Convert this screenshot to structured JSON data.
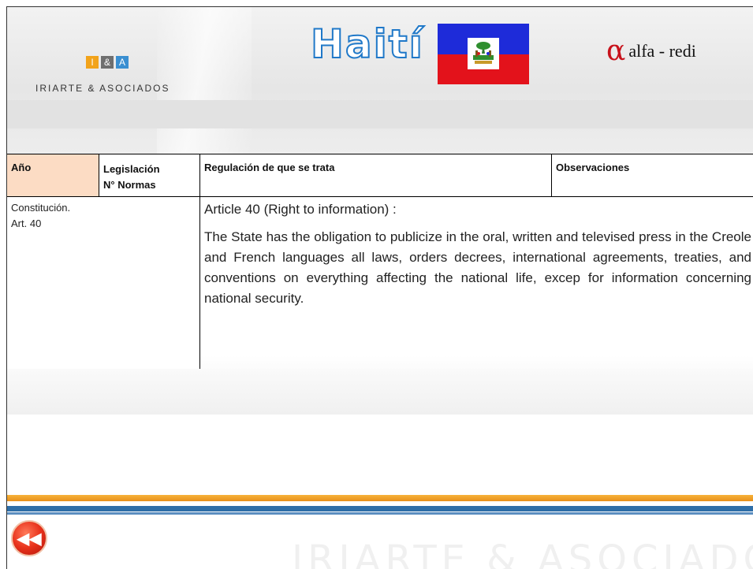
{
  "header": {
    "ia_logo": {
      "letter_i": "I",
      "letter_amp": "&",
      "letter_a": "A",
      "company": "IRIARTE & ASOCIADOS"
    },
    "title": "Haití",
    "flag": {
      "country": "Haiti",
      "colors": {
        "top": "#1e2bd9",
        "bottom": "#e3121b"
      }
    },
    "alfa_logo": {
      "symbol": "α",
      "text": "alfa - redi"
    }
  },
  "table": {
    "headers": {
      "anio": "Año",
      "legislacion_1": "Legislación",
      "legislacion_2": "N° Normas",
      "regulacion": "Regulación de que se trata",
      "observaciones": "Observaciones"
    },
    "row": {
      "legislacion_1": "Constitución.",
      "legislacion_2": "Art. 40",
      "article_title": "Article 40 (Right to information) :",
      "article_body": "The State has the obligation to publicize in the oral, written and televised press in the Creole and French languages all laws, orders decrees, international agreements, treaties, and conventions on everything affecting the national life, excep for information concerning national security."
    }
  },
  "footer": {
    "back_button_symbol": "◀◀",
    "watermark": "IRIARTE & ASOCIADOS",
    "colors": {
      "orange": "#f7b23b",
      "blue": "#2e6ea8",
      "back_button": "#e8321b"
    }
  }
}
